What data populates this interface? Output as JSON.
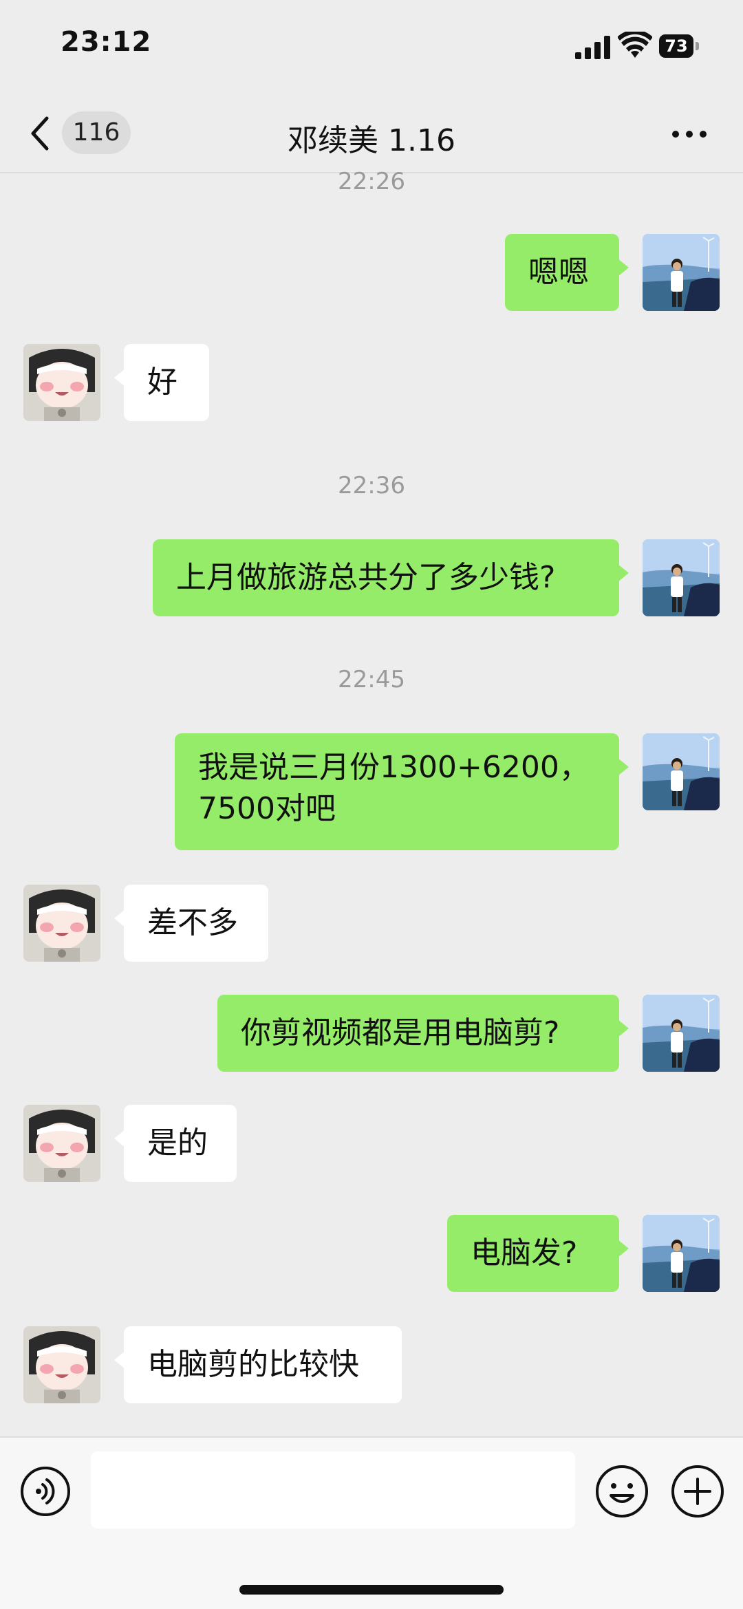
{
  "status_bar": {
    "time": "23:12",
    "battery": "73"
  },
  "nav": {
    "unread_count": "116",
    "title": "邓续美 1.16"
  },
  "messages": [
    {
      "kind": "time",
      "text": "22:26"
    },
    {
      "kind": "me",
      "text": "嗯嗯"
    },
    {
      "kind": "other",
      "text": "好"
    },
    {
      "kind": "time",
      "text": "22:36"
    },
    {
      "kind": "me",
      "text": "上月做旅游总共分了多少钱?"
    },
    {
      "kind": "time",
      "text": "22:45"
    },
    {
      "kind": "me",
      "text": "我是说三月份1300+6200，"
    },
    {
      "kind": "me",
      "text": "7500对吧"
    },
    {
      "kind": "other",
      "text": "差不多"
    },
    {
      "kind": "me",
      "text": "你剪视频都是用电脑剪?"
    },
    {
      "kind": "other",
      "text": "是的"
    },
    {
      "kind": "me",
      "text": "电脑发?"
    },
    {
      "kind": "other",
      "text": "电脑剪的比较快"
    }
  ],
  "input": {
    "value": "",
    "placeholder": ""
  },
  "icons": {
    "back": "chevron-left-icon",
    "more": "ellipsis-icon",
    "voice": "voice-icon",
    "emoji": "emoji-icon",
    "plus": "plus-icon",
    "signal": "cellular-signal-icon",
    "wifi": "wifi-icon",
    "battery": "battery-icon"
  },
  "colors": {
    "background": "#ededed",
    "my_bubble": "#95ec69",
    "other_bubble": "#ffffff",
    "timestamp": "#9a9a9a"
  }
}
